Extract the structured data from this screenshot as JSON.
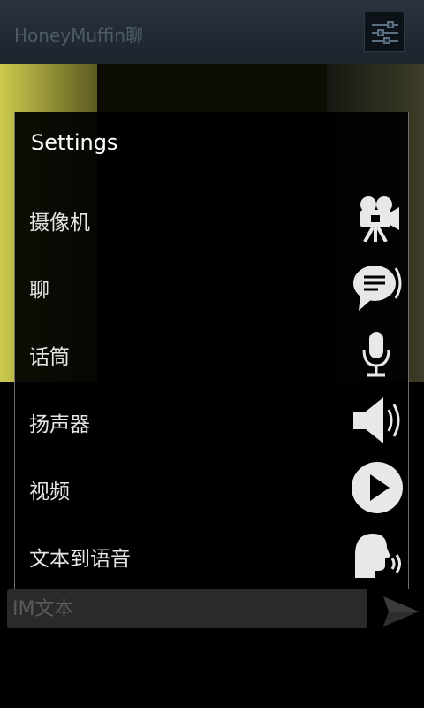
{
  "app": {
    "title": "HoneyMuffin聊"
  },
  "dialog": {
    "title": "Settings",
    "items": [
      {
        "label": "摄像机",
        "icon": "video-camera-icon"
      },
      {
        "label": "聊",
        "icon": "chat-bubble-icon"
      },
      {
        "label": "话筒",
        "icon": "microphone-icon"
      },
      {
        "label": "扬声器",
        "icon": "speaker-icon"
      },
      {
        "label": "视频",
        "icon": "play-icon"
      },
      {
        "label": "文本到语音",
        "icon": "speaking-head-icon"
      }
    ]
  },
  "input": {
    "placeholder": "IM文本"
  },
  "send": {
    "icon": "send-icon"
  },
  "colors": {
    "titlebar": "#1c232c",
    "dialog_border": "#6d6d6d",
    "icon": "#e8e8e8"
  }
}
